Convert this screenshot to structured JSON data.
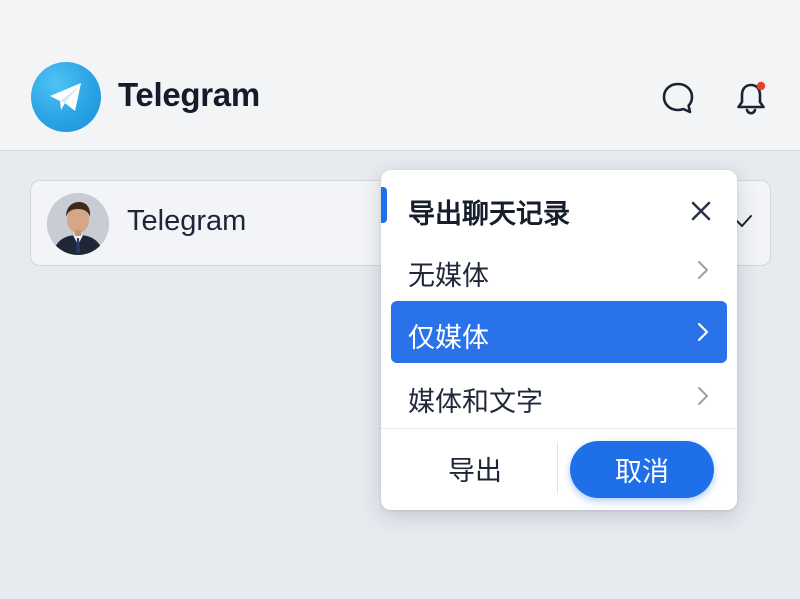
{
  "app": {
    "title": "Telegram",
    "accent_color": "#2aa3e6",
    "logo_icon": "paper-plane-icon"
  },
  "header": {
    "actions": [
      {
        "icon": "chat-bubble-icon"
      },
      {
        "icon": "bell-icon",
        "has_notification": true,
        "badge_color": "#e8412c"
      }
    ]
  },
  "chat": {
    "name": "Telegram",
    "avatar": "profile-photo",
    "status_icon": "check-icon"
  },
  "dialog": {
    "title": "导出聊天记录",
    "close_icon": "close-icon",
    "options": [
      {
        "label": "无媒体",
        "selected": false
      },
      {
        "label": "仅媒体",
        "selected": true
      },
      {
        "label": "媒体和文字",
        "selected": false
      }
    ],
    "export_label": "导出",
    "cancel_label": "取消",
    "primary_color": "#1f6fe8"
  }
}
